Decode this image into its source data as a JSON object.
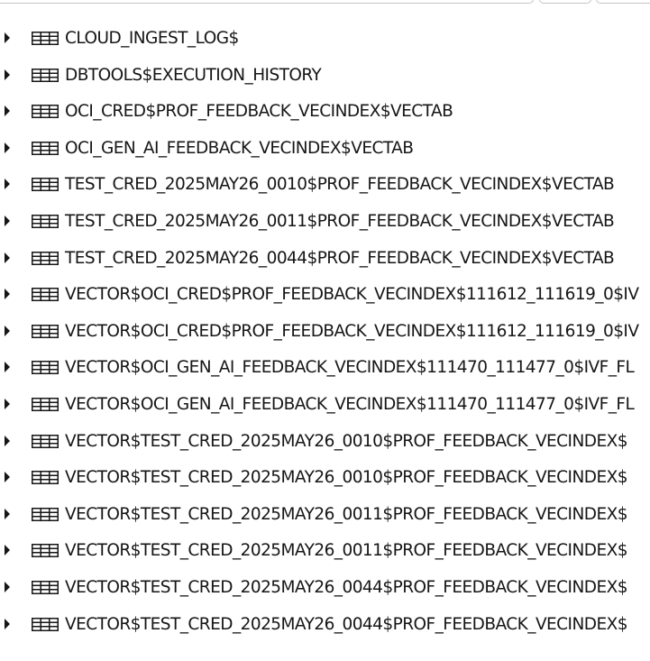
{
  "tree": {
    "items": [
      {
        "label": "CLOUD_INGEST_LOG$"
      },
      {
        "label": "DBTOOLS$EXECUTION_HISTORY"
      },
      {
        "label": "OCI_CRED$PROF_FEEDBACK_VECINDEX$VECTAB"
      },
      {
        "label": "OCI_GEN_AI_FEEDBACK_VECINDEX$VECTAB"
      },
      {
        "label": "TEST_CRED_2025MAY26_0010$PROF_FEEDBACK_VECINDEX$VECTAB"
      },
      {
        "label": "TEST_CRED_2025MAY26_0011$PROF_FEEDBACK_VECINDEX$VECTAB"
      },
      {
        "label": "TEST_CRED_2025MAY26_0044$PROF_FEEDBACK_VECINDEX$VECTAB"
      },
      {
        "label": "VECTOR$OCI_CRED$PROF_FEEDBACK_VECINDEX$111612_111619_0$IV"
      },
      {
        "label": "VECTOR$OCI_CRED$PROF_FEEDBACK_VECINDEX$111612_111619_0$IV"
      },
      {
        "label": "VECTOR$OCI_GEN_AI_FEEDBACK_VECINDEX$111470_111477_0$IVF_FL"
      },
      {
        "label": "VECTOR$OCI_GEN_AI_FEEDBACK_VECINDEX$111470_111477_0$IVF_FL"
      },
      {
        "label": "VECTOR$TEST_CRED_2025MAY26_0010$PROF_FEEDBACK_VECINDEX$"
      },
      {
        "label": "VECTOR$TEST_CRED_2025MAY26_0010$PROF_FEEDBACK_VECINDEX$"
      },
      {
        "label": "VECTOR$TEST_CRED_2025MAY26_0011$PROF_FEEDBACK_VECINDEX$"
      },
      {
        "label": "VECTOR$TEST_CRED_2025MAY26_0011$PROF_FEEDBACK_VECINDEX$"
      },
      {
        "label": "VECTOR$TEST_CRED_2025MAY26_0044$PROF_FEEDBACK_VECINDEX$"
      },
      {
        "label": "VECTOR$TEST_CRED_2025MAY26_0044$PROF_FEEDBACK_VECINDEX$"
      }
    ]
  },
  "icons": {
    "expand": "caret-right-icon",
    "table": "table-icon"
  },
  "colors": {
    "text": "#161616",
    "border": "#c4c4c4",
    "background": "#ffffff"
  }
}
